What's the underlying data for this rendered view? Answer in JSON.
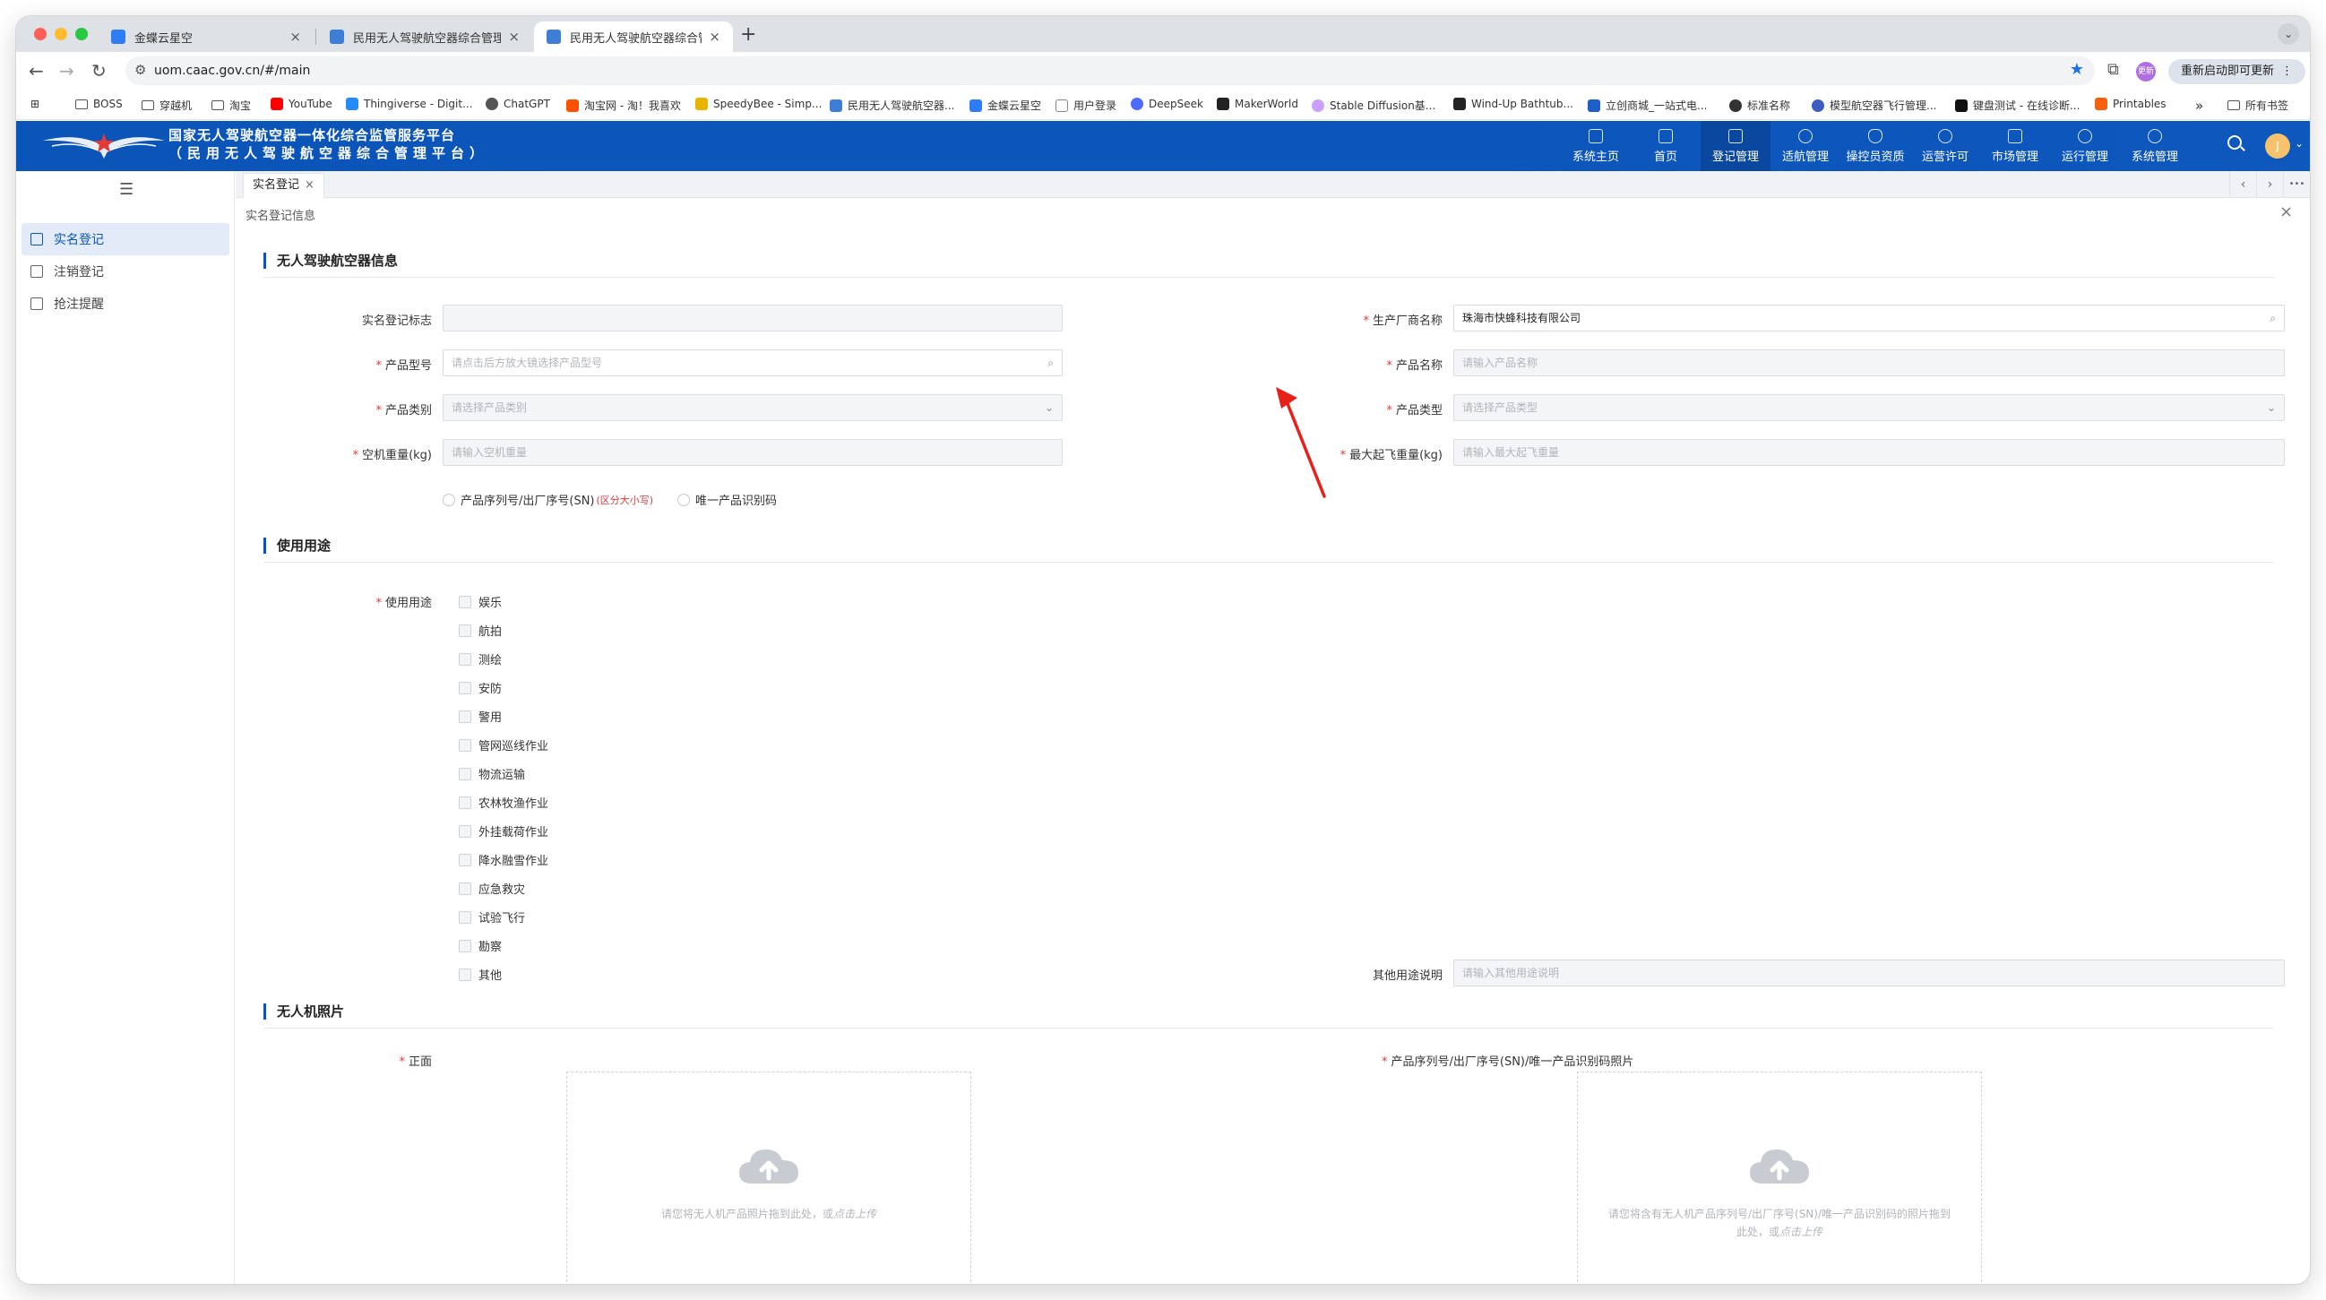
{
  "browser": {
    "tabs": [
      {
        "title": "金蝶云星空",
        "active": false
      },
      {
        "title": "民用无人驾驶航空器综合管理平",
        "active": false
      },
      {
        "title": "民用无人驾驶航空器综合管理平",
        "active": true
      }
    ],
    "url": "uom.caac.gov.cn/#/main",
    "update_button": "重新启动即可更新",
    "profile_badge": "更新",
    "bookmarks": [
      "BOSS",
      "穿越机",
      "淘宝",
      "YouTube",
      "Thingiverse - Digit...",
      "ChatGPT",
      "淘宝网 - 淘！我喜欢",
      "SpeedyBee - Simp...",
      "民用无人驾驶航空器...",
      "金蝶云星空",
      "用户登录",
      "DeepSeek",
      "MakerWorld",
      "Stable Diffusion基...",
      "Wind-Up Bathtub...",
      "立创商城_一站式电...",
      "标准名称",
      "模型航空器飞行管理...",
      "键盘测试 - 在线诊断...",
      "Printables"
    ],
    "bookmarks_overflow": "»",
    "all_bookmarks": "所有书签"
  },
  "app": {
    "title_line1": "国家无人驾驶航空器一体化综合监管服务平台",
    "title_line2": "（民用无人驾驶航空器综合管理平台）",
    "nav": [
      {
        "label": "系统主页",
        "active": false
      },
      {
        "label": "首页",
        "active": false
      },
      {
        "label": "登记管理",
        "active": true
      },
      {
        "label": "适航管理",
        "active": false
      },
      {
        "label": "操控员资质",
        "active": false
      },
      {
        "label": "运营许可",
        "active": false
      },
      {
        "label": "市场管理",
        "active": false
      },
      {
        "label": "运行管理",
        "active": false
      },
      {
        "label": "系统管理",
        "active": false
      }
    ],
    "user_initial": "J"
  },
  "sidebar": {
    "items": [
      {
        "label": "实名登记",
        "active": true
      },
      {
        "label": "注销登记",
        "active": false
      },
      {
        "label": "抢注提醒",
        "active": false
      }
    ]
  },
  "tabsbar": {
    "open_tab": "实名登记",
    "close": "×",
    "prev": "‹",
    "next": "›",
    "more": "•••"
  },
  "breadcrumb": "实名登记信息",
  "form": {
    "section_aircraft": "无人驾驶航空器信息",
    "reg_mark_label": "实名登记标志",
    "reg_mark_value": "",
    "manufacturer_label": "生产厂商名称",
    "manufacturer_value": "珠海市快蜂科技有限公司",
    "product_model_label": "产品型号",
    "product_model_placeholder": "请点击后方放大镜选择产品型号",
    "product_name_label": "产品名称",
    "product_name_placeholder": "请输入产品名称",
    "product_category_label": "产品类别",
    "product_category_placeholder": "请选择产品类别",
    "product_type_label": "产品类型",
    "product_type_placeholder": "请选择产品类型",
    "empty_weight_label": "空机重量(kg)",
    "empty_weight_placeholder": "请输入空机重量",
    "max_takeoff_label": "最大起飞重量(kg)",
    "max_takeoff_placeholder": "请输入最大起飞重量",
    "radio_sn": "产品序列号/出厂序号(SN)",
    "radio_sn_hint": "(区分大小写)",
    "radio_uid": "唯一产品识别码",
    "section_usage": "使用用途",
    "usage_label": "使用用途",
    "usage_options": [
      "娱乐",
      "航拍",
      "测绘",
      "安防",
      "警用",
      "管网巡线作业",
      "物流运输",
      "农林牧渔作业",
      "外挂载荷作业",
      "降水融雪作业",
      "应急救灾",
      "试验飞行",
      "勘察",
      "其他"
    ],
    "other_usage_label": "其他用途说明",
    "other_usage_placeholder": "请输入其他用途说明",
    "section_photos": "无人机照片",
    "front_label": "正面",
    "sn_photo_label": "产品序列号/出厂序号(SN)/唯一产品识别码照片",
    "upload1_text": "请您将无人机产品照片拖到此处，或",
    "upload1_link": "点击上传",
    "upload2_text_line1": "请您将含有无人机产品序列号/出厂序号(SN)/唯一产品识别码的照片拖到",
    "upload2_text_line2": "此处，或",
    "upload2_link": "点击上传"
  },
  "colors": {
    "header_blue": "#0b55b8",
    "required_red": "#e03a3a",
    "annotation_arrow": "#e8201a"
  }
}
